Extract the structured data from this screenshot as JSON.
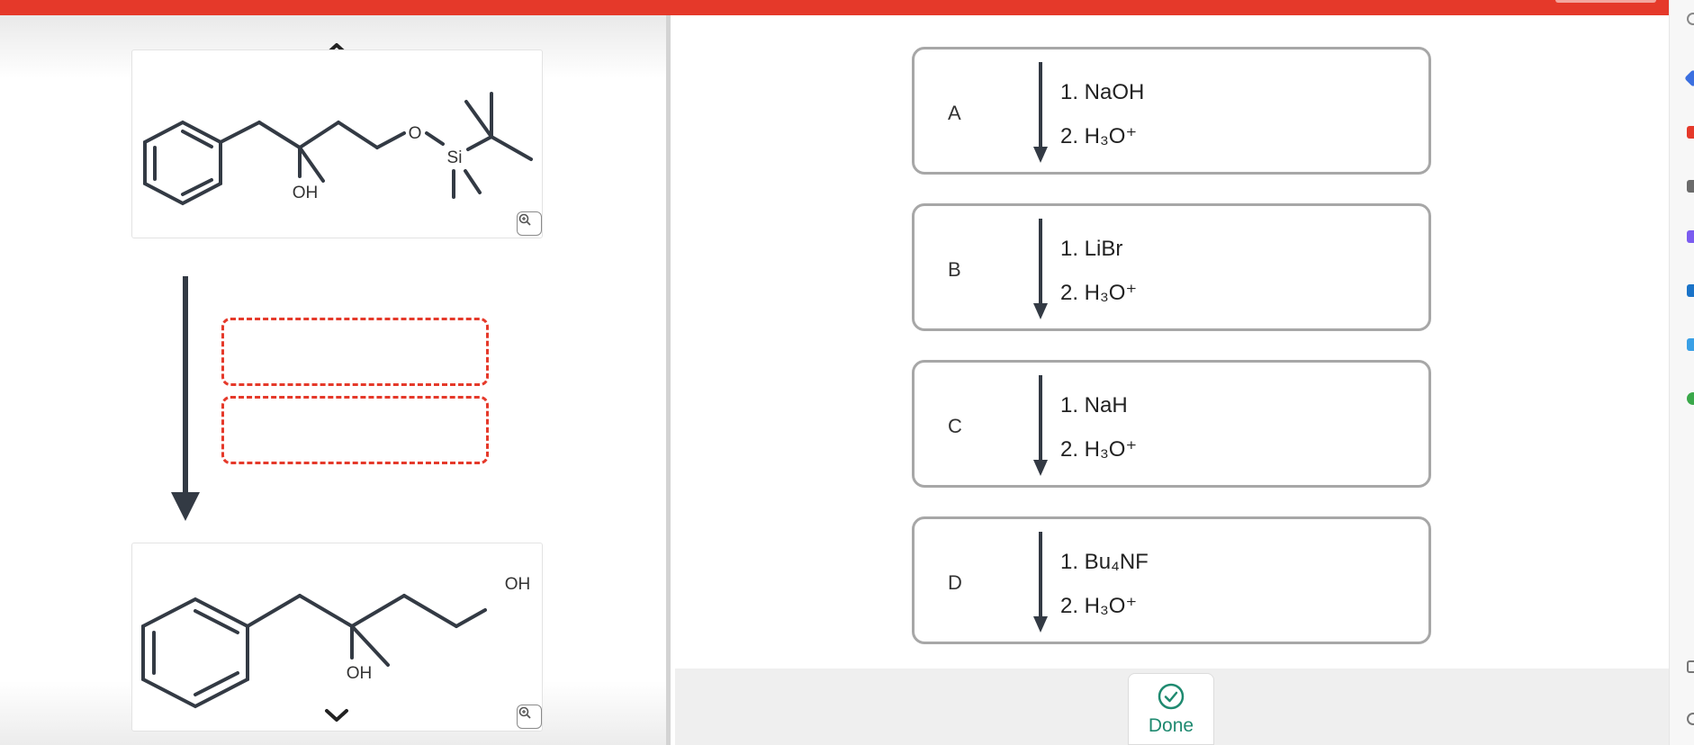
{
  "reaction": {
    "start_labels": {
      "oxygen": "O",
      "silicon": "Si",
      "hydroxyl": "OH"
    },
    "product_labels": {
      "hydroxyl_primary": "OH",
      "hydroxyl_tertiary": "OH"
    },
    "blanks": [
      "",
      ""
    ]
  },
  "options": [
    {
      "letter": "A",
      "step1": "1. NaOH",
      "step2": "2. H₃O⁺"
    },
    {
      "letter": "B",
      "step1": "1. LiBr",
      "step2": "2. H₃O⁺"
    },
    {
      "letter": "C",
      "step1": "1. NaH",
      "step2": "2. H₃O⁺"
    },
    {
      "letter": "D",
      "step1": "1. Bu₄NF",
      "step2": "2. H₃O⁺"
    }
  ],
  "footer": {
    "done_label": "Done"
  },
  "colors": {
    "brand_red": "#e5392a",
    "done_green": "#1f8a70",
    "bond": "#333a44"
  },
  "icons": [
    "zoom-in-icon",
    "chevron-up-icon",
    "chevron-down-icon",
    "check-circle-icon",
    "reaction-arrow-icon"
  ]
}
